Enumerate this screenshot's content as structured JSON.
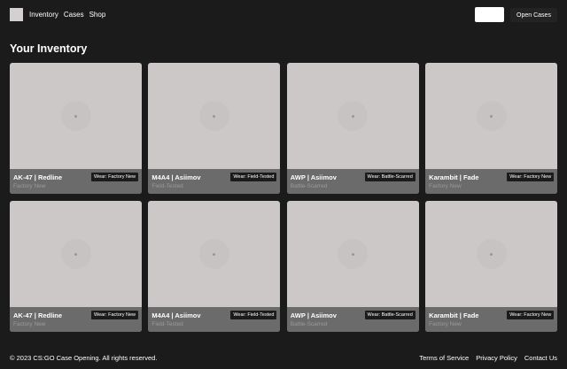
{
  "nav": {
    "links": [
      "Inventory",
      "Cases",
      "Shop"
    ],
    "cta": "Open Cases"
  },
  "page": {
    "title": "Your Inventory"
  },
  "cards": [
    {
      "name": "AK-47 | Redline",
      "sub": "Factory New",
      "wear": "Wear: Factory New"
    },
    {
      "name": "M4A4 | Asiimov",
      "sub": "Field-Tested",
      "wear": "Wear: Field-Tested"
    },
    {
      "name": "AWP | Asiimov",
      "sub": "Battle-Scarred",
      "wear": "Wear: Battle-Scarred"
    },
    {
      "name": "Karambit | Fade",
      "sub": "Factory New",
      "wear": "Wear: Factory New"
    },
    {
      "name": "AK-47 | Redline",
      "sub": "Factory New",
      "wear": "Wear: Factory New"
    },
    {
      "name": "M4A4 | Asiimov",
      "sub": "Field-Tested",
      "wear": "Wear: Field-Tested"
    },
    {
      "name": "AWP | Asiimov",
      "sub": "Battle-Scarred",
      "wear": "Wear: Battle-Scarred"
    },
    {
      "name": "Karambit | Fade",
      "sub": "Factory New",
      "wear": "Wear: Factory New"
    }
  ],
  "footer": {
    "copyright": "© 2023 CS:GO Case Opening. All rights reserved.",
    "links": [
      "Terms of Service",
      "Privacy Policy",
      "Contact Us"
    ]
  },
  "colors": {
    "background": "#1b1b1b",
    "card": "#cdc8c8",
    "card_footer": "#6b6b6b",
    "badge": "#1b1b1b"
  }
}
